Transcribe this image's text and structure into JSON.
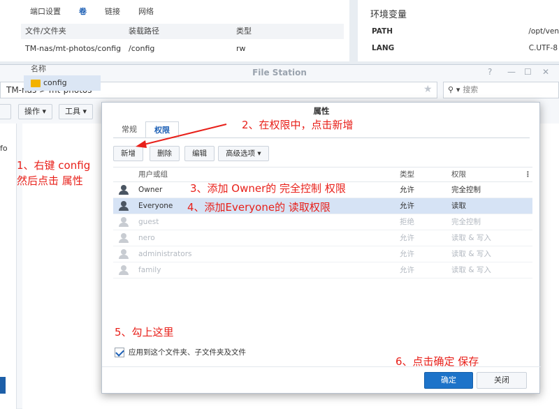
{
  "background": {
    "tabs": [
      "端口设置",
      "卷",
      "链接",
      "网络"
    ],
    "active_tab": "卷",
    "table_headers": [
      "文件/文件夹",
      "装载路径",
      "类型"
    ],
    "rows": [
      [
        "TM-nas/mt-photos/config",
        "/config",
        "rw"
      ]
    ],
    "env_title": "环境变量",
    "env": [
      {
        "key": "PATH",
        "value": "/opt/ven"
      },
      {
        "key": "LANG",
        "value": "C.UTF-8"
      }
    ],
    "left_fragment": "fo"
  },
  "file_station": {
    "title": "File Station",
    "path": "TM-nas  >  mt-photos",
    "search_placeholder": "搜索",
    "toolbar": {
      "action": "操作 ▾",
      "tools": "工具 ▾"
    },
    "column_name": "名称",
    "folder": "config"
  },
  "dialog": {
    "title": "属性",
    "tabs": [
      "常规",
      "权限"
    ],
    "buttons": {
      "add": "新增",
      "delete": "删除",
      "edit": "编辑",
      "advanced": "高级选项 ▾"
    },
    "headers": {
      "user": "用户或组",
      "type": "类型",
      "perm": "权限",
      "more": "⋮"
    },
    "rows": [
      {
        "user": "Owner",
        "type": "允许",
        "perm": "完全控制",
        "dim": false,
        "selected": false
      },
      {
        "user": "Everyone",
        "type": "允许",
        "perm": "读取",
        "dim": false,
        "selected": true
      },
      {
        "user": "guest",
        "type": "拒绝",
        "perm": "完全控制",
        "dim": true,
        "selected": false
      },
      {
        "user": "nero",
        "type": "允许",
        "perm": "读取 & 写入",
        "dim": true,
        "selected": false
      },
      {
        "user": "administrators",
        "type": "允许",
        "perm": "读取 & 写入",
        "dim": true,
        "selected": false
      },
      {
        "user": "family",
        "type": "允许",
        "perm": "读取 & 写入",
        "dim": true,
        "selected": false
      }
    ],
    "apply_label": "应用到这个文件夹、子文件夹及文件",
    "ok": "确定",
    "close": "关闭"
  },
  "annotations": {
    "step1a": "1、右键 config",
    "step1b": "然后点击 属性",
    "step2": "2、在权限中，点击新增",
    "step3": "3、添加 Owner的 完全控制 权限",
    "step4": "4、添加Everyone的 读取权限",
    "step5": "5、勾上这里",
    "step6": "6、点击确定 保存"
  },
  "colors": {
    "accent": "#1d73c9",
    "annotation": "#e8201a",
    "selected_row": "#d6e3f5"
  }
}
